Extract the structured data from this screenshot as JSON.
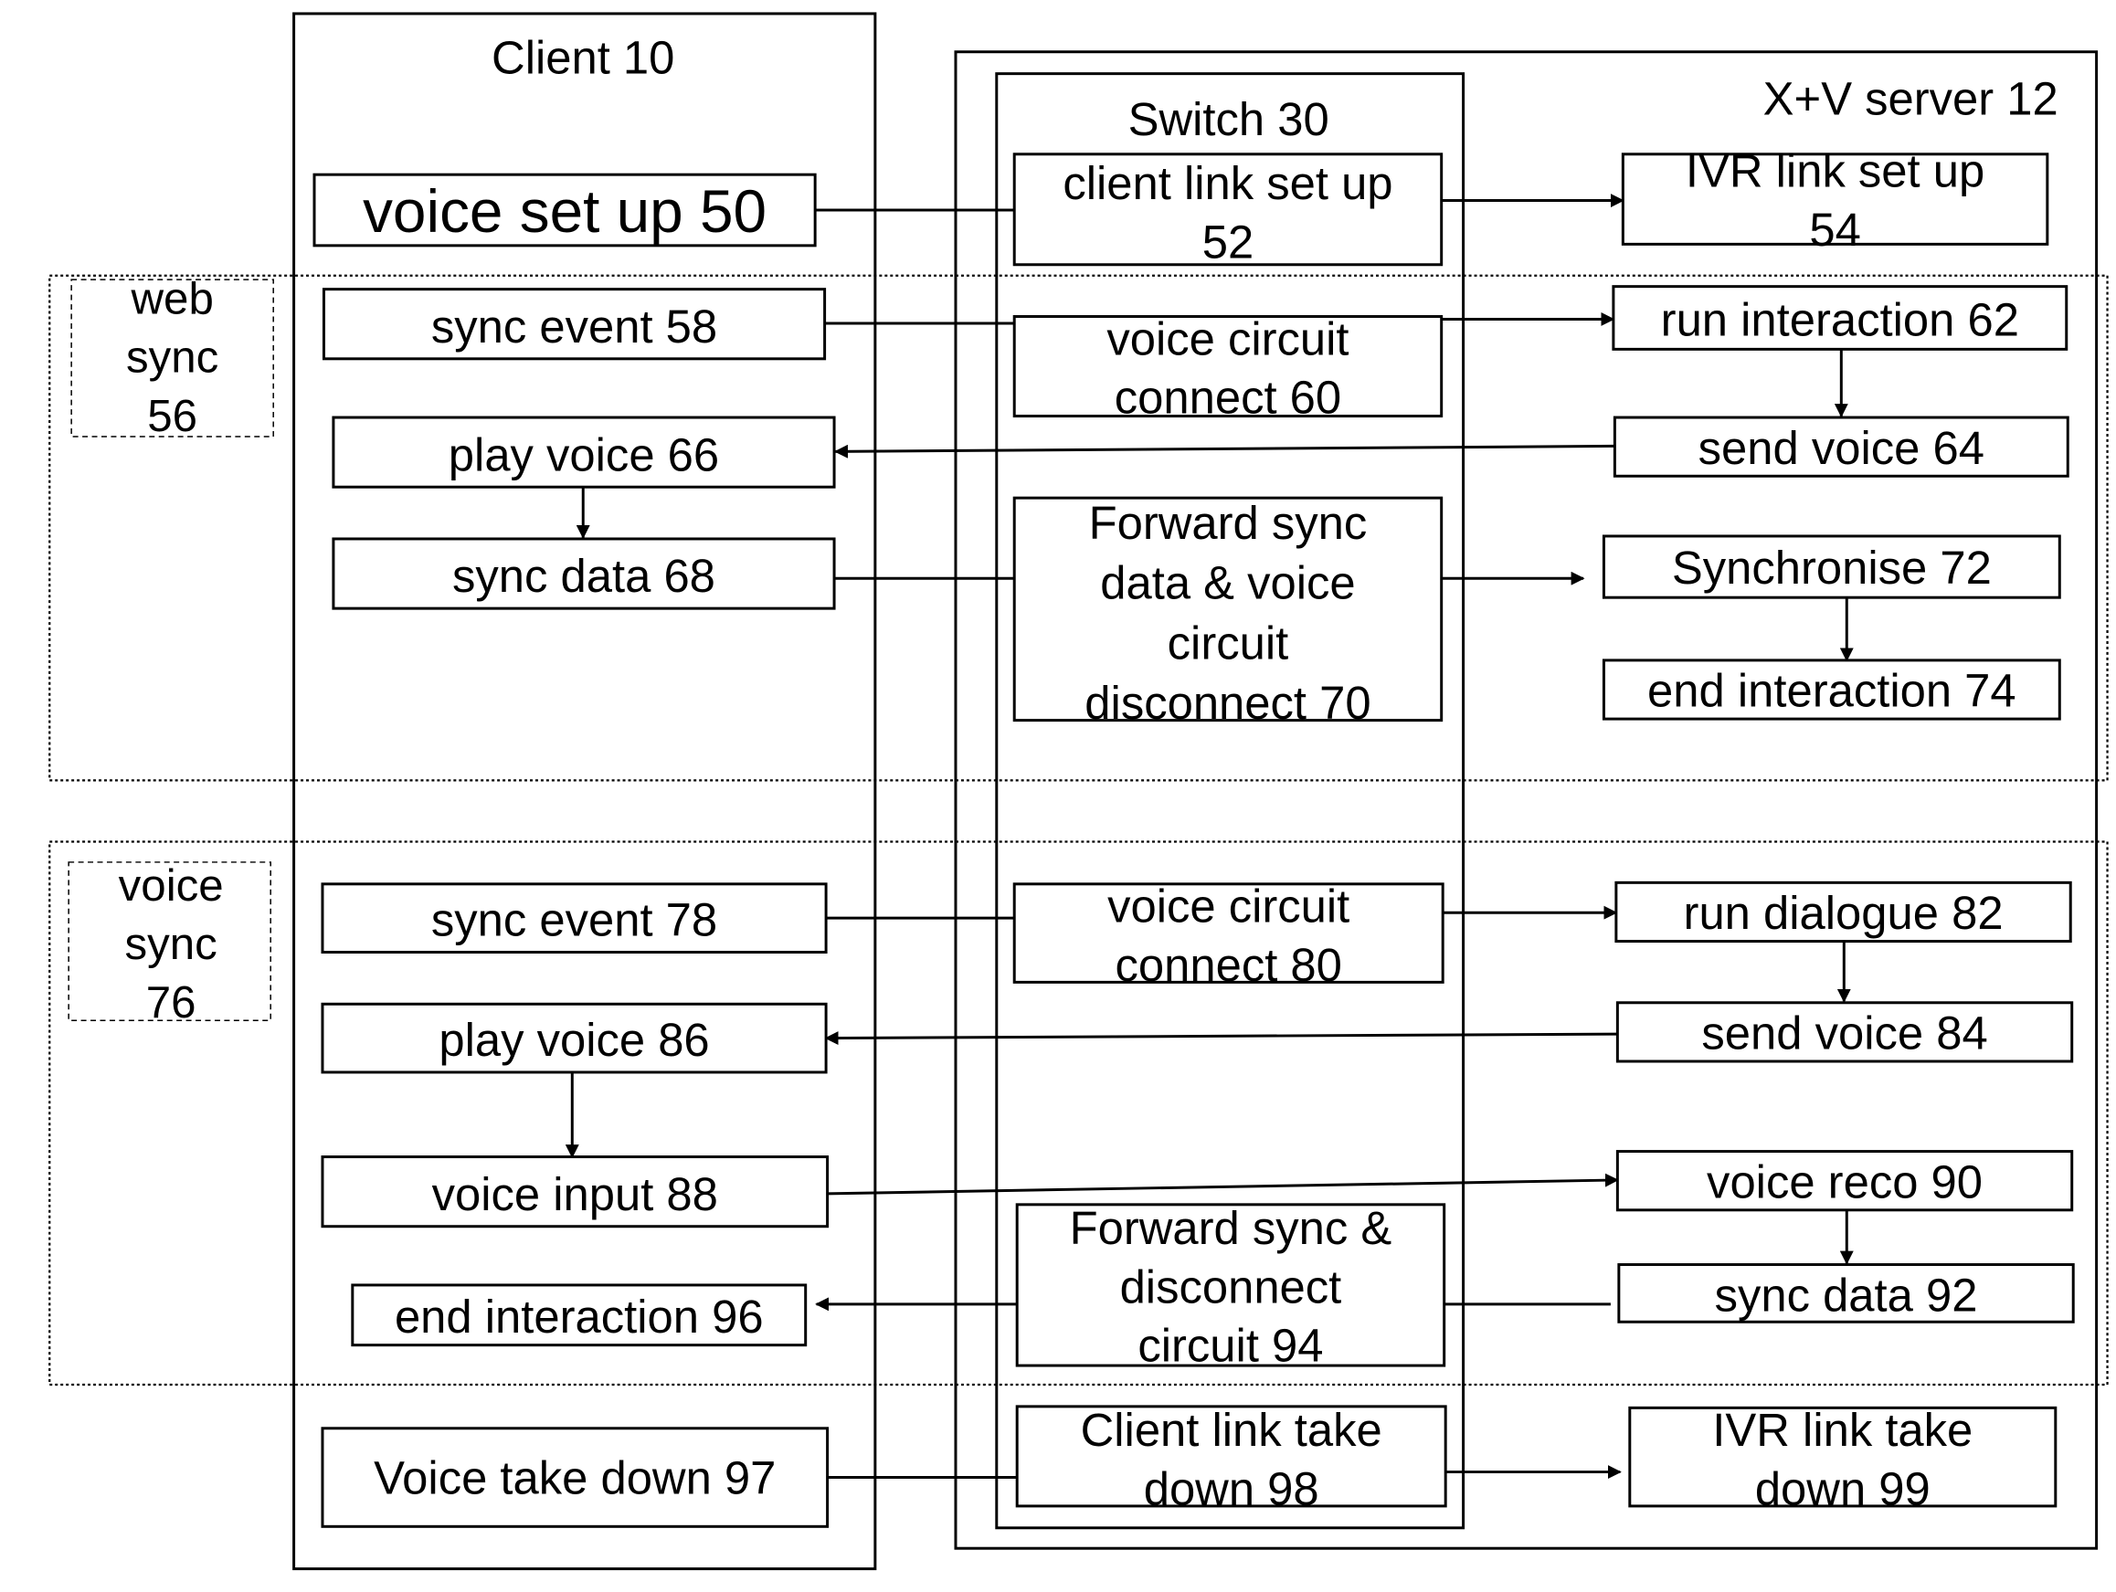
{
  "lanes": {
    "client": "Client 10",
    "switch": "Switch 30",
    "server": "X+V server 12"
  },
  "groups": {
    "web_sync": [
      "web",
      "sync",
      "56"
    ],
    "voice_sync": [
      "voice",
      "sync",
      "76"
    ]
  },
  "nodes": {
    "n50": [
      "voice set up 50"
    ],
    "n52": [
      "client link set up",
      "52"
    ],
    "n54": [
      "IVR link set up",
      "54"
    ],
    "n58": [
      "sync event 58"
    ],
    "n60": [
      "voice circuit",
      "connect 60"
    ],
    "n62": [
      "run interaction 62"
    ],
    "n64": [
      "send voice 64"
    ],
    "n66": [
      "play voice 66"
    ],
    "n68": [
      "sync data 68"
    ],
    "n70": [
      "Forward sync",
      "data & voice",
      "circuit",
      "disconnect 70"
    ],
    "n72": [
      "Synchronise 72"
    ],
    "n74": [
      "end interaction 74"
    ],
    "n78": [
      "sync event 78"
    ],
    "n80": [
      "voice circuit",
      "connect 80"
    ],
    "n82": [
      "run dialogue 82"
    ],
    "n84": [
      "send voice 84"
    ],
    "n86": [
      "play voice 86"
    ],
    "n88": [
      "voice input 88"
    ],
    "n90": [
      "voice reco 90"
    ],
    "n92": [
      "sync data 92"
    ],
    "n94": [
      "Forward sync &",
      "disconnect",
      "circuit 94"
    ],
    "n96": [
      "end interaction 96"
    ],
    "n97": [
      "Voice take down 97"
    ],
    "n98": [
      "Client link take",
      "down 98"
    ],
    "n99": [
      "IVR link take",
      "down 99"
    ]
  }
}
